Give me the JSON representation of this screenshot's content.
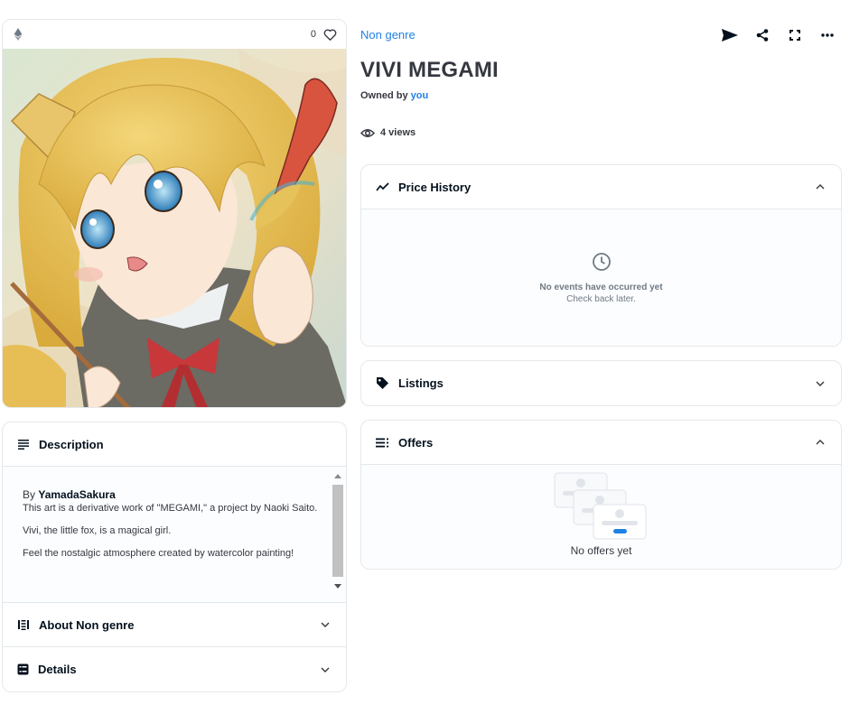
{
  "item": {
    "favorites_count": "0",
    "collection_name": "Non genre",
    "title": "VIVI MEGAMI",
    "owned_by_label": "Owned by",
    "owner": "you",
    "views": "4 views"
  },
  "description_panel": {
    "header": "Description",
    "by_label": "By",
    "creator": "YamadaSakura",
    "paragraphs": [
      "This art is a derivative work of \"MEGAMI,\" a project by Naoki Saito.",
      "Vivi, the little fox, is a magical girl.",
      "Feel the nostalgic atmosphere created by watercolor painting!"
    ]
  },
  "about_panel": {
    "header": "About Non genre"
  },
  "details_panel": {
    "header": "Details"
  },
  "price_history": {
    "header": "Price History",
    "empty_title": "No events have occurred yet",
    "empty_sub": "Check back later."
  },
  "listings": {
    "header": "Listings"
  },
  "offers": {
    "header": "Offers",
    "empty": "No offers yet"
  },
  "icons": {
    "chain": "ethereum-icon",
    "favorite": "heart-icon",
    "actions": [
      "send-icon",
      "share-icon",
      "fullscreen-icon",
      "more-icon"
    ]
  },
  "colors": {
    "link": "#2081e2",
    "text": "#353840",
    "border": "#e5e8eb",
    "panel_bg": "#fbfdff"
  }
}
